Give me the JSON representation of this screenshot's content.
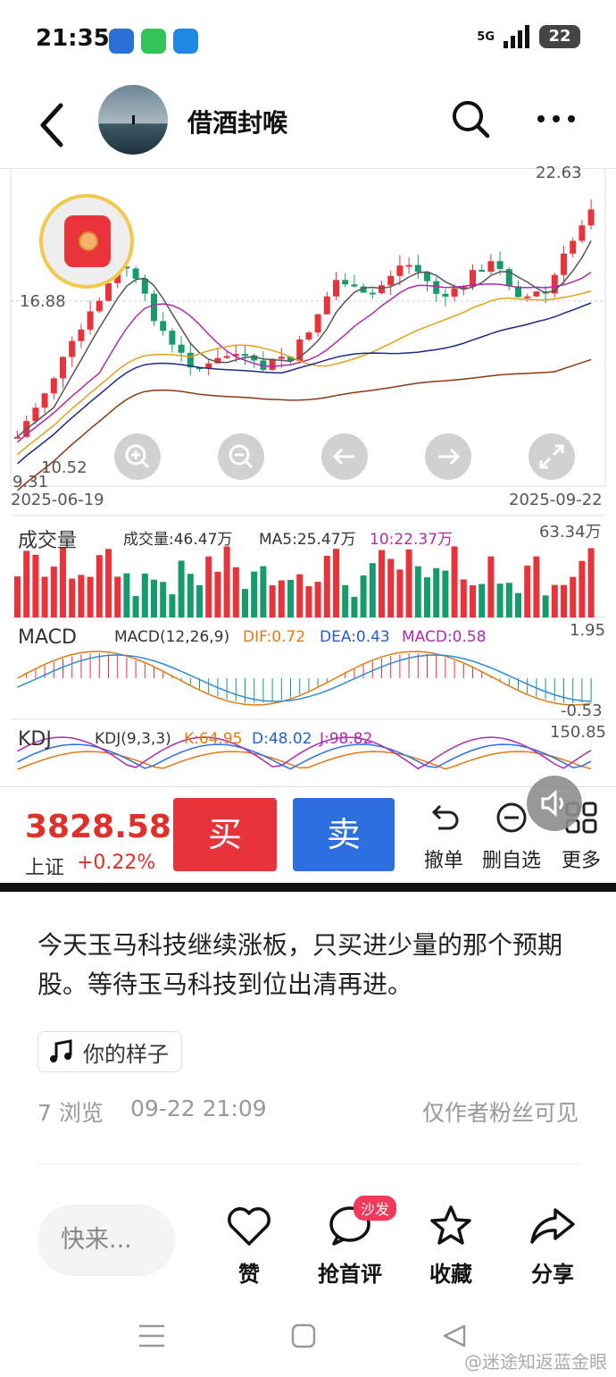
{
  "status_bar": {
    "time": "21:35",
    "signal": "5G",
    "battery": "22"
  },
  "header": {
    "author": "借酒封喉"
  },
  "stock_chart": {
    "price_high": "22.63",
    "price_mark": "16.88",
    "price_low_1": "10.52",
    "price_low_2": "9.31",
    "date_start": "2025-06-19",
    "date_end": "2025-09-22",
    "volume": {
      "label": "成交量",
      "value": "成交量:46.47万",
      "ma5": "MA5:25.47万",
      "ma10": "10:22.37万",
      "max": "63.34万"
    },
    "macd": {
      "label": "MACD",
      "params": "MACD(12,26,9)",
      "dif": "DIF:0.72",
      "dea": "DEA:0.43",
      "macd": "MACD:0.58",
      "max": "1.95",
      "min": "-0.53"
    },
    "kdj": {
      "label": "KDJ",
      "params": "KDJ(9,3,3)",
      "k": "K:64.95",
      "d": "D:48.02",
      "j": "J:98.82",
      "max": "150.85"
    }
  },
  "trade_bar": {
    "index_value": "3828.58",
    "index_name": "上证",
    "index_change": "+0.22%",
    "buy": "买",
    "sell": "卖",
    "actions": [
      "撤单",
      "删自选",
      "更多"
    ]
  },
  "post": {
    "text": "今天玉马科技继续涨板，只买进少量的那个预期股。等待玉马科技到位出清再进。",
    "music": "你的样子",
    "views": "7 浏览",
    "date": "09-22 21:09",
    "visibility": "仅作者粉丝可见"
  },
  "bottom_bar": {
    "comment_placeholder": "快来...",
    "like": "赞",
    "comment": "抢首评",
    "sofa_badge": "沙发",
    "favorite": "收藏",
    "share": "分享"
  },
  "watermark": "@迷途知返蓝金眼",
  "colors": {
    "up": "#e8333a",
    "down": "#169b6b",
    "accent_blue": "#2e6fe0"
  }
}
